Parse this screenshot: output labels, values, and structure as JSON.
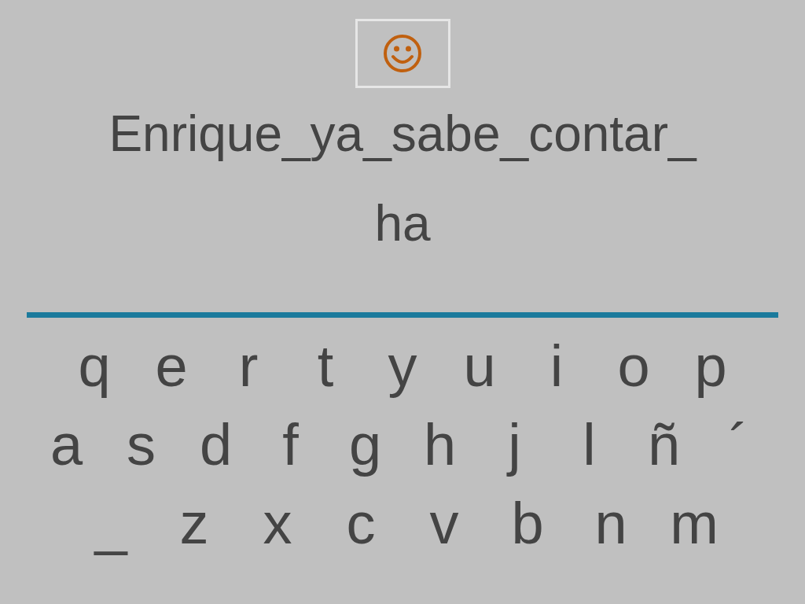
{
  "sentence": "Enrique_ya_sabe_contar_",
  "answer": "ha",
  "keyboard": [
    [
      "q",
      "e",
      "r",
      "t",
      "y",
      "u",
      "i",
      "o",
      "p"
    ],
    [
      "a",
      "s",
      "d",
      "f",
      "g",
      "h",
      "j",
      "l",
      "ñ",
      "´"
    ],
    [
      "_",
      "z",
      "x",
      "c",
      "v",
      "b",
      "n",
      "m"
    ]
  ]
}
